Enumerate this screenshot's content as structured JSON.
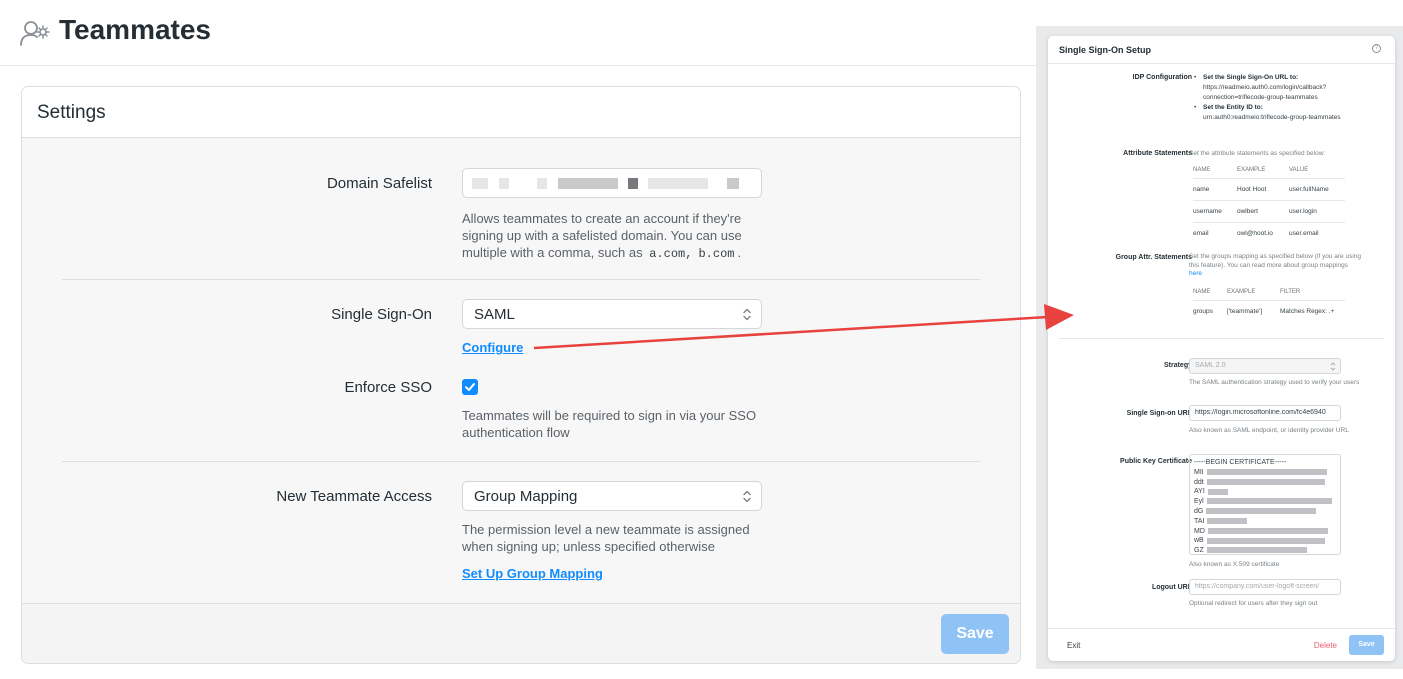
{
  "header": {
    "title": "Teammates",
    "icon": "users-gear-icon"
  },
  "settings": {
    "title": "Settings",
    "domain_safelist": {
      "label": "Domain Safelist",
      "help_prefix": "Allows teammates to create an account if they're signing up with a safelisted domain. You can use multiple with a comma, such as",
      "example_1": "a.com,",
      "example_2": "b.com",
      "help_suffix": "."
    },
    "sso": {
      "label": "Single Sign-On",
      "value": "SAML",
      "configure_link": "Configure"
    },
    "enforce_sso": {
      "label": "Enforce SSO",
      "checked": true,
      "help": "Teammates will be required to sign in via your SSO authentication flow"
    },
    "access": {
      "label": "New Teammate Access",
      "value": "Group Mapping",
      "help": "The permission level a new teammate is assigned when signing up; unless specified otherwise",
      "link": "Set Up Group Mapping"
    },
    "save_label": "Save",
    "accent": "#118cfd"
  },
  "sso_panel": {
    "title": "Single Sign-On Setup",
    "help_icon": "?",
    "idp": {
      "label": "IDP Configuration",
      "item1_title": "Set the Single Sign-On URL to:",
      "item1_value": "https://readmeio.auth0.com/login/callback?connection=triflecode-group-teammates",
      "item2_title": "Set the Entity ID to:",
      "item2_value": "urn:auth0:readmeio:triflecode-group-teammates"
    },
    "attributes": {
      "label": "Attribute Statements",
      "intro": "Set the attribute statements as specified below:",
      "headers": [
        "NAME",
        "EXAMPLE",
        "VALUE"
      ],
      "rows": [
        [
          "name",
          "Hoot Hoot",
          "user.fullName"
        ],
        [
          "username",
          "owlbert",
          "user.login"
        ],
        [
          "email",
          "owl@hoot.io",
          "user.email"
        ]
      ]
    },
    "groups": {
      "label": "Group Attr. Statements",
      "intro": "Set the groups mapping as specified below (if you are using this feature). You can read more about group mappings",
      "intro_link": "here",
      "headers": [
        "NAME",
        "EXAMPLE",
        "FILTER"
      ],
      "rows": [
        [
          "groups",
          "['teammate']",
          "Matches Regex: .+"
        ]
      ]
    },
    "strategy": {
      "label": "Strategy",
      "value": "SAML 2.0",
      "help": "The SAML authentication strategy used to verify your users"
    },
    "sso_url": {
      "label": "Single Sign-on URL",
      "value": "https://login.microsoftonline.com/fc4e6940",
      "help": "Also known as SAML endpoint, or identity provider URL"
    },
    "cert": {
      "label": "Public Key Certificate",
      "first_line": "-----BEGIN CERTIFICATE-----",
      "line_prefixes": [
        "MII",
        "ddt",
        "AYI",
        "Eyl",
        "dG",
        "TAI",
        "MD",
        "wB",
        "GZ"
      ],
      "help": "Also known as X.509 certificate"
    },
    "logout": {
      "label": "Logout URL",
      "placeholder": "https://company.com/user-logoff-screen/",
      "help": "Optional redirect for users after they sign out"
    },
    "exit_label": "Exit",
    "delete_label": "Delete",
    "save_label": "Save"
  },
  "annotation": {
    "arrow_color": "#e8423f"
  }
}
